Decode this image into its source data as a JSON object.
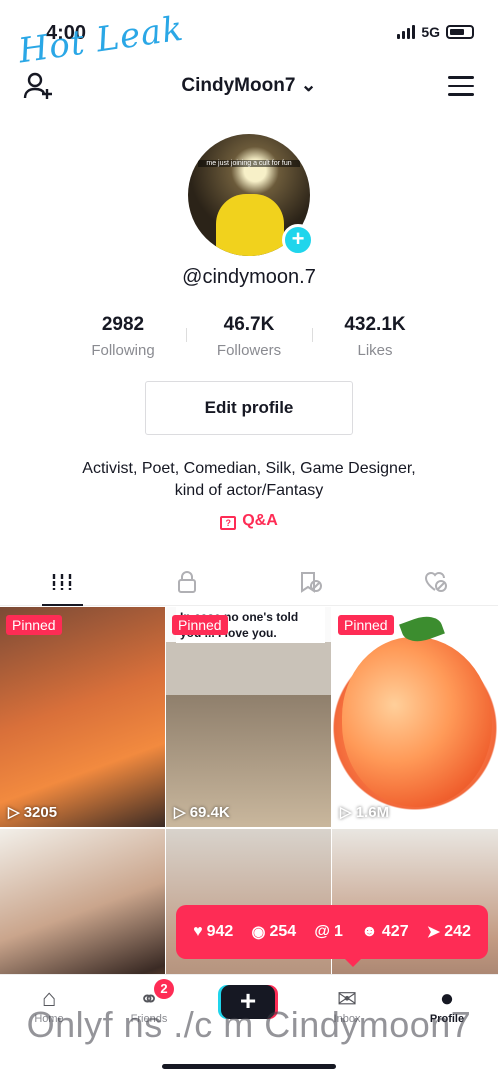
{
  "status_bar": {
    "time": "4:00",
    "network": "5G",
    "battery_icon": "battery-icon"
  },
  "watermark": {
    "top_logo": "Hot Leak",
    "bottom_text": "Onlyf ns ./c m Cindymoon7"
  },
  "header": {
    "username": "CindyMoon7",
    "add_user_icon": "add-user-icon",
    "menu_icon": "hamburger-menu-icon"
  },
  "avatar": {
    "caption": "me just joining a cult for fun",
    "add_icon": "plus-icon"
  },
  "profile": {
    "handle": "@cindymoon.7",
    "stats": [
      {
        "value": "2982",
        "label": "Following"
      },
      {
        "value": "46.7K",
        "label": "Followers"
      },
      {
        "value": "432.1K",
        "label": "Likes"
      }
    ],
    "edit_button": "Edit profile",
    "bio_line1": "Activist, Poet, Comedian, Silk, Game Designer,",
    "bio_line2": "kind of actor/Fantasy",
    "qa_label": "Q&A"
  },
  "tabs": [
    {
      "icon": "videos-grid-icon",
      "active": true
    },
    {
      "icon": "lock-icon",
      "active": false
    },
    {
      "icon": "favorites-icon",
      "active": false
    },
    {
      "icon": "liked-icon",
      "active": false
    }
  ],
  "videos": [
    {
      "pinned": "Pinned",
      "views": "3205"
    },
    {
      "pinned": "Pinned",
      "views": "69.4K",
      "overlay": "In case no one's told you ... I love you."
    },
    {
      "pinned": "Pinned",
      "views": "1.6M"
    },
    {
      "views": ""
    },
    {
      "views": ""
    },
    {
      "views": ""
    }
  ],
  "activity": {
    "likes": "942",
    "comments": "254",
    "mentions": "1",
    "followers": "427",
    "shares": "242"
  },
  "bottom_nav": {
    "home": "Home",
    "friends": "Friends",
    "friends_badge": "2",
    "create": "+",
    "inbox": "Inbox",
    "profile": "Profile"
  }
}
